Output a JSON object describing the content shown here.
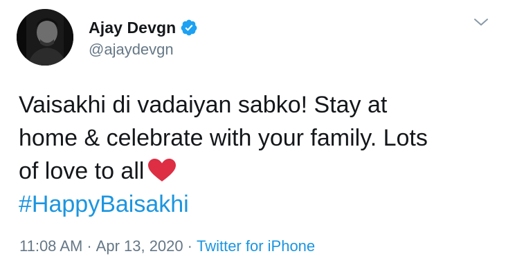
{
  "user": {
    "display_name": "Ajay Devgn",
    "handle": "@ajaydevgn",
    "verified": true
  },
  "tweet": {
    "lines": [
      "Vaisakhi di vadaiyan sabko! Stay at",
      "home & celebrate with your family. Lots",
      "of love to all"
    ],
    "emoji": "heart",
    "hashtag": "#HappyBaisakhi"
  },
  "meta": {
    "time": "11:08 AM",
    "separator1": "·",
    "date": "Apr 13, 2020",
    "separator2": "·",
    "source": "Twitter for iPhone"
  },
  "colors": {
    "link": "#1b95e0",
    "secondary_text": "#657786",
    "primary_text": "#14171a",
    "verified_badge": "#1da1f2",
    "heart": "#dd2e44"
  },
  "icons": {
    "verified": "verified-badge-icon",
    "caret": "chevron-down-icon",
    "emoji": "red-heart-emoji"
  }
}
